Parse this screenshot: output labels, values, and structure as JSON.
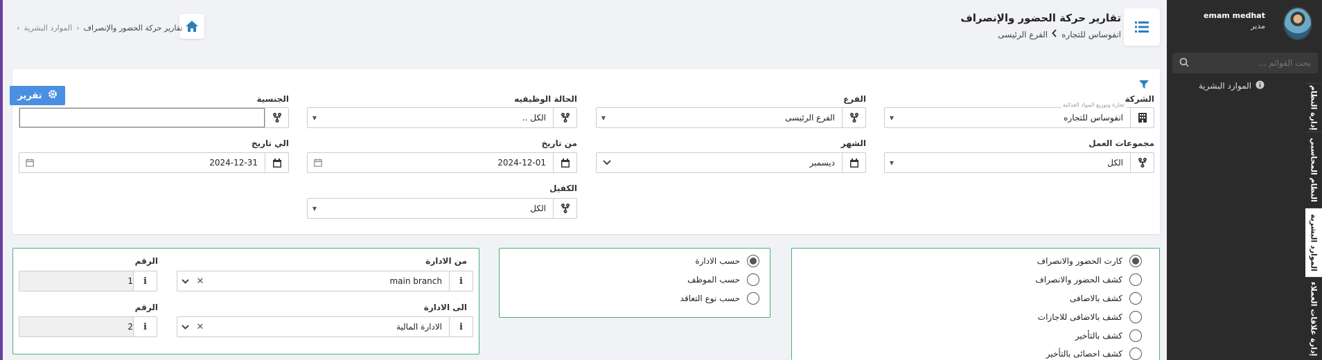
{
  "header": {
    "title": "تقارير حركة الحضور والإنصراف",
    "company": "انفوساس للتجاره",
    "branch": "الفرع الرئيسى"
  },
  "breadcrumb": {
    "parent": "الموارد البشرية",
    "current": "تقارير حركة الحضور والإنصراف"
  },
  "sidebar": {
    "user_name": "emam medhat",
    "user_role": "مدير",
    "search_placeholder": "بحث القوائم ...",
    "active_section": "الموارد البشرية",
    "tabs": [
      "إدارة النظام",
      "النظام المحاسبي",
      "الموارد البشرية",
      "إدارة علاقات العملاء"
    ]
  },
  "filters": {
    "report_button": "تقرير",
    "company_label": "الشركة",
    "company_hint": "تجارة وتوزيع المواد الغذائية",
    "company_value": "انفوساس للتجاره",
    "branch_label": "الفرع",
    "branch_value": "الفرع الرئيسى",
    "job_status_label": "الحالة الوظيفيه",
    "job_status_value": "الكل ..",
    "nationality_label": "الجنسية",
    "nationality_value": "",
    "work_groups_label": "مجموعات العمل",
    "work_groups_value": "الكل",
    "month_label": "الشهر",
    "month_value": "ديسمبر",
    "from_date_label": "من تاريخ",
    "from_date_value": "2024-12-01",
    "to_date_label": "الي تاريخ",
    "to_date_value": "2024-12-31",
    "sponsor_label": "الكفيل",
    "sponsor_value": "الكل"
  },
  "report_types": [
    {
      "label": "كارت الحضور والانصراف",
      "selected": true
    },
    {
      "label": "كشف الحضور والانصراف",
      "selected": false
    },
    {
      "label": "كشف بالاضافى",
      "selected": false
    },
    {
      "label": "كشف بالاضافى للاجازات",
      "selected": false
    },
    {
      "label": "كشف بالتأخير",
      "selected": false
    },
    {
      "label": "كشف احصائى بالتأخير",
      "selected": false
    }
  ],
  "group_by": [
    {
      "label": "حسب الادارة",
      "selected": true
    },
    {
      "label": "حسب الموظف",
      "selected": false
    },
    {
      "label": "حسب نوع التعاقد",
      "selected": false
    }
  ],
  "department_range": {
    "from_label": "من الادارة",
    "from_value": "main branch",
    "from_num_label": "الرقم",
    "from_num": "1",
    "to_label": "الى الادارة",
    "to_value": "الادارة المالية",
    "to_num_label": "الرقم",
    "to_num": "2",
    "info_glyph": "i"
  },
  "colors": {
    "accent": "#4a90e2",
    "sidebar": "#2b2b2b",
    "box_border": "#4ab07a"
  }
}
